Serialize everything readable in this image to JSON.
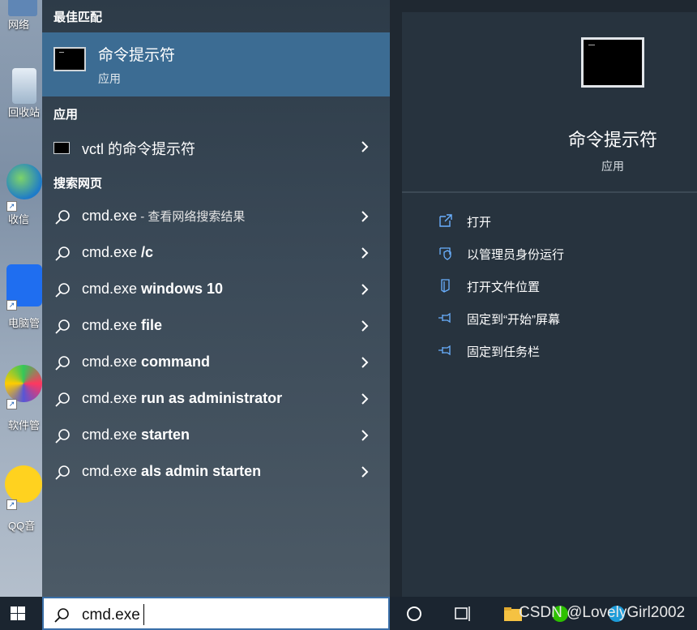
{
  "desktop": {
    "icons": [
      {
        "label": "网络"
      },
      {
        "label": "回收站"
      },
      {
        "label": "收信"
      },
      {
        "label": "电脑管"
      },
      {
        "label": "软件管"
      },
      {
        "label": "QQ音"
      }
    ]
  },
  "search": {
    "best_match_header": "最佳匹配",
    "best_match": {
      "title": "命令提示符",
      "subtitle": "应用"
    },
    "apps_header": "应用",
    "apps": [
      {
        "name": "vctl 的命令提示符"
      }
    ],
    "web_header": "搜索网页",
    "web_results": [
      {
        "prefix": "cmd.exe",
        "bold": "",
        "suffix": " - 查看网络搜索结果"
      },
      {
        "prefix": "cmd.exe ",
        "bold": "/c",
        "suffix": ""
      },
      {
        "prefix": "cmd.exe ",
        "bold": "windows 10",
        "suffix": ""
      },
      {
        "prefix": "cmd.exe ",
        "bold": "file",
        "suffix": ""
      },
      {
        "prefix": "cmd.exe ",
        "bold": "command",
        "suffix": ""
      },
      {
        "prefix": "cmd.exe ",
        "bold": "run as administrator",
        "suffix": ""
      },
      {
        "prefix": "cmd.exe ",
        "bold": "starten",
        "suffix": ""
      },
      {
        "prefix": "cmd.exe ",
        "bold": "als admin starten",
        "suffix": ""
      }
    ]
  },
  "preview": {
    "title": "命令提示符",
    "subtitle": "应用",
    "actions": [
      {
        "label": "打开",
        "icon": "open-icon"
      },
      {
        "label": "以管理员身份运行",
        "icon": "shield-icon"
      },
      {
        "label": "打开文件位置",
        "icon": "file-location-icon"
      },
      {
        "label": "固定到“开始”屏幕",
        "icon": "pin-icon"
      },
      {
        "label": "固定到任务栏",
        "icon": "pin-icon"
      }
    ]
  },
  "taskbar": {
    "search_value": "cmd.exe",
    "watermark": "CSDN @LovelyGirl2002"
  },
  "colors": {
    "accent": "#3c6c93",
    "panel_left": "#3b4a58",
    "panel_right": "#27333e",
    "taskbar": "#1b2530"
  }
}
